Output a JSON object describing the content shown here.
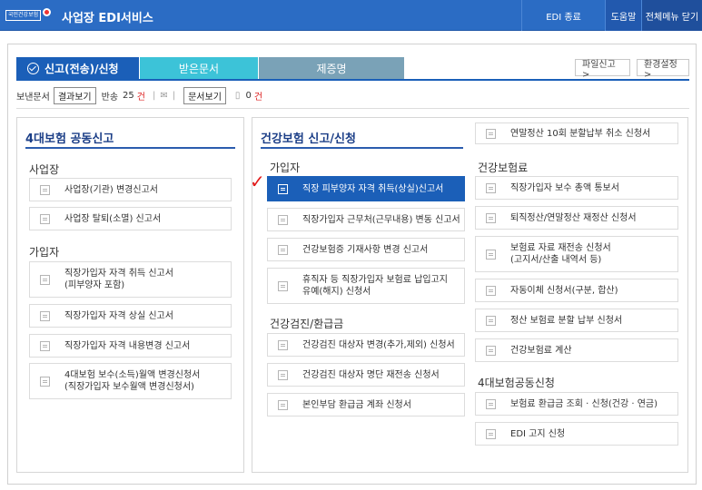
{
  "header": {
    "logo_text": "국민건강보험",
    "app_title": "사업장 EDI서비스",
    "nav": {
      "edi_end": "EDI 종료",
      "help": "도움말",
      "close_all": "전체메뉴 닫기"
    }
  },
  "tabs": {
    "send": "신고(전송)/신청",
    "receive": "받은문서",
    "certificate": "제증명"
  },
  "top_buttons": {
    "file_report": "파일신고 >",
    "settings": "환경설정 >"
  },
  "subbar": {
    "sent_label": "보낸문서",
    "result_button": "결과보기",
    "returned_label": "반송",
    "returned_count": "25",
    "unit": "건",
    "doc_button": "문서보기",
    "doc_count": "0"
  },
  "left_panel": {
    "title": "4대보험 공동신고",
    "workplace_heading": "사업장",
    "workplace_items": [
      "사업장(기관) 변경신고서",
      "사업장 탈퇴(소멸) 신고서"
    ],
    "subscriber_heading": "가입자",
    "subscriber_items": [
      "직장가입자 자격 취득 신고서\n(피부양자 포함)",
      "직장가입자 자격 상실 신고서",
      "직장가입자 자격 내용변경 신고서",
      "4대보험 보수(소득)월액 변경신청서\n(직장가입자 보수월액 변경신청서)"
    ]
  },
  "right_panel": {
    "title": "건강보험 신고/신청",
    "top_item": "연말정산 10회 분할납부 취소 신청서",
    "subscriber_heading": "가입자",
    "subscriber_items": [
      "직장 피부양자 자격 취득(상실)신고서",
      "직장가입자 근무처(근무내용) 변동 신고서",
      "건강보험증 기재사항 변경 신고서",
      "휴직자 등 직장가입자 보험료 납입고지\n유예(해지) 신청서"
    ],
    "checkup_heading": "건강검진/환급금",
    "checkup_items": [
      "건강검진 대상자 변경(추가,제외) 신청서",
      "건강검진 대상자 명단 재전송 신청서",
      "본인부담 환급금 계좌 신청서"
    ],
    "premium_heading": "건강보험료",
    "premium_items": [
      "직장가입자 보수 총액 통보서",
      "퇴직정산/연말정산 재정산 신청서",
      "보험료 자료 재전송 신청서\n(고지서/산출 내역서 등)",
      "자동이체 신청서(구분, 합산)",
      "정산 보험료 분할 납부 신청서",
      "건강보험료 계산"
    ],
    "joint_heading": "4대보험공동신청",
    "joint_items": [
      "보험료 환급금 조회 · 신청(건강 · 연금)",
      "EDI 고지 신청"
    ]
  },
  "colors": {
    "header_blue": "#2b6cc4",
    "active_tab": "#1b5fb8",
    "recv_tab": "#3cc3d8",
    "cert_tab": "#7aa2b7",
    "check_red": "#e21b1b"
  }
}
